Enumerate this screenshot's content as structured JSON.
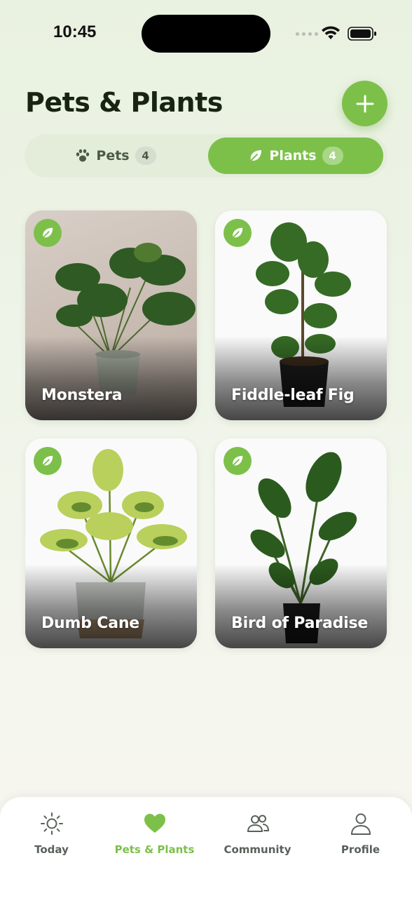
{
  "status_bar": {
    "time": "10:45"
  },
  "header": {
    "title": "Pets & Plants"
  },
  "tabs": [
    {
      "label": "Pets",
      "count": "4",
      "icon": "paw-icon",
      "active": false
    },
    {
      "label": "Plants",
      "count": "4",
      "icon": "leaf-icon",
      "active": true
    }
  ],
  "plants": [
    {
      "name": "Monstera",
      "badge_icon": "leaf-icon"
    },
    {
      "name": "Fiddle-leaf Fig",
      "badge_icon": "leaf-icon"
    },
    {
      "name": "Dumb Cane",
      "badge_icon": "leaf-icon"
    },
    {
      "name": "Bird of Paradise",
      "badge_icon": "leaf-icon"
    }
  ],
  "nav": [
    {
      "label": "Today",
      "icon": "sun-icon",
      "active": false
    },
    {
      "label": "Pets & Plants",
      "icon": "heart-icon",
      "active": true
    },
    {
      "label": "Community",
      "icon": "people-icon",
      "active": false
    },
    {
      "label": "Profile",
      "icon": "person-icon",
      "active": false
    }
  ],
  "colors": {
    "accent": "#7cc04a",
    "title": "#18240f",
    "nav_inactive": "#59605a"
  }
}
